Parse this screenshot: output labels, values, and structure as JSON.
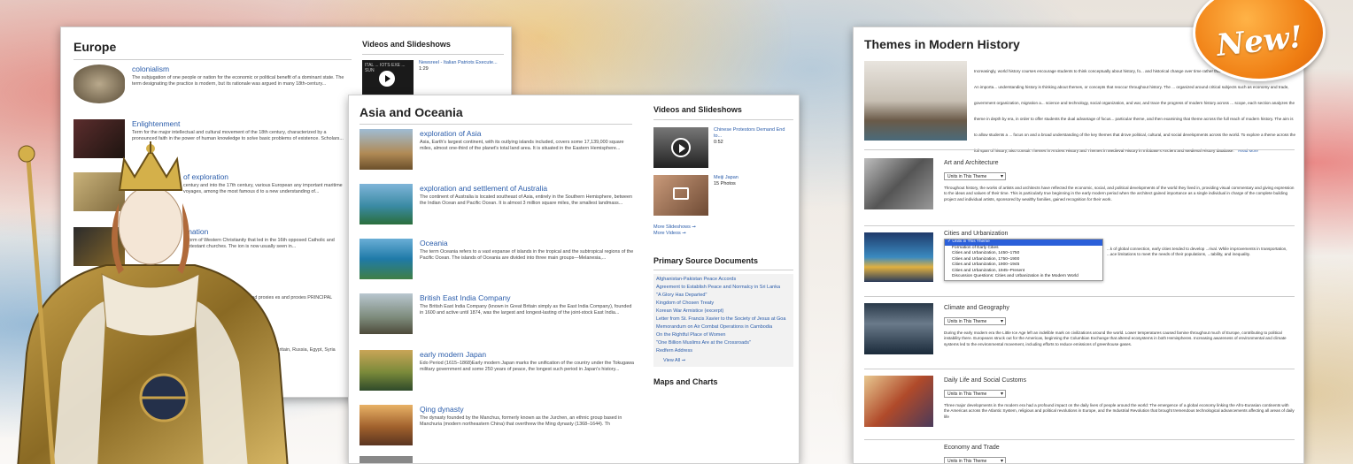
{
  "badge": "New!",
  "europe": {
    "title": "Europe",
    "entries": [
      {
        "title": "colonialism",
        "desc": "The subjugation of one people or nation for the economic or political benefit of a dominant state. The term designating the practice is modern, but its rationale was argued in many 18th-century..."
      },
      {
        "title": "Enlightenment",
        "desc": "Term for the major intellectual and cultural movement of the 18th century, characterized by a pronounced faith in the power of human knowledge to solve basic problems of existence. Scholars..."
      },
      {
        "title": "of exploration",
        "desc": "century and into the 17th century, various European any important maritime voyages, among the most famous d to a new understanding of..."
      },
      {
        "title": "rmation",
        "desc": "reform of Western Christianity that led in the 16th opposed Catholic and Protestant churches. The ion is now usually seen in..."
      },
      {
        "title": "",
        "desc": "tes and its capitalist allies and proxies es and proxies PRINCIPAL"
      },
      {
        "title": "",
        "desc": "an powers, Great Britain, Russia, Egypt, Syria"
      }
    ],
    "videos_title": "Videos and Slideshows",
    "video": {
      "title": "Newsreel - Italian Patriots Execute...",
      "duration": "1:29",
      "thumb_text": "ITAL ... IOTS EXE ... SUN"
    }
  },
  "asia": {
    "title": "Asia and Oceania",
    "entries": [
      {
        "title": "exploration of Asia",
        "desc": "Asia, Earth's largest continent, with its outlying islands included, covers some 17,139,000 square miles, almost one-third of the planet's total land area. It is situated in the Eastern Hemisphere..."
      },
      {
        "title": "exploration and settlement of Australia",
        "desc": "The continent of Australia is located southeast of Asia, entirely in the Southern Hemisphere, between the Indian Ocean and Pacific Ocean. It is almost 3 million square miles, the smallest landmass..."
      },
      {
        "title": "Oceania",
        "desc": "The term Oceania refers to a vast expanse of islands in the tropical and the subtropical regions of the Pacific Ocean. The islands of Oceania are divided into three main groups—Melanesia,..."
      },
      {
        "title": "British East India Company",
        "desc": "The British East India Company (known in Great Britain simply as the East India Company), founded in 1600 and active until 1874, was the largest and longest-lasting of the joint-stock East India..."
      },
      {
        "title": "early modern Japan",
        "desc": "Edo Period (1615–1868)Early modern Japan marks the unification of the country under the Tokugawa military government and some 250 years of peace, the longest such period in Japan's history..."
      },
      {
        "title": "Qing dynasty",
        "desc": "The dynasty founded by the Manchus, formerly known as the Jurchen, an ethnic group based in Manchuria (modern northeastern China) that overthrew the Ming dynasty (1368–1644). Th"
      }
    ],
    "videos_title": "Videos and Slideshows",
    "videos": [
      {
        "title": "Chinese Protestors Demand End to...",
        "meta": "0:52"
      },
      {
        "title": "Meiji Japan",
        "meta": "15 Photos"
      }
    ],
    "more_slideshows": "More Slideshows ➞",
    "more_videos": "More Videos ➞",
    "psd_title": "Primary Source Documents",
    "psd": [
      "Afghanistan-Pakistan Peace Accords",
      "Agreement to Establish Peace and Normalcy in Sri Lanka",
      "\"A Glory Has Departed\"",
      "Kingdom of Chosen Treaty",
      "Korean War Armistice (excerpt)",
      "Letter from St. Francis Xavier to the Society of Jesus at Goa",
      "Memorandum on Air Combat Operations in Cambodia",
      "On the Rightful Place of Women",
      "\"One Billion Muslims Are at the Crossroads\"",
      "Redfern Address"
    ],
    "view_all": "View All ➞",
    "maps_title": "Maps and Charts"
  },
  "themes": {
    "title": "Themes in Modern History",
    "intro": "Increasingly, world history courses encourage students to think conceptually about history, fo... and historical change over time rather than on the histories of individual civilizations. An importa... understanding history is thinking about themes, or concepts that reoccur throughout history. The ... organized around critical subjects such as economy and trade, government organization, migration a... science and technology, social organization, and war, and trace the progress of modern history across ... scope, each section analyzes the theme in depth by era, in order to offer students the dual advantage of focus... particular theme, and then examining that theme across the full reach of modern history. The aim is to allow students a ... focus on and a broad understanding of the key themes that drove political, cultural, and social developments across the world. To explore a theme across the full span of history, also consult Themes in Ancient History and Themes in Medieval History in Infobase's Ancient and Medieval History database.",
    "read_more": "Read More",
    "sections": [
      {
        "title": "Art and Architecture",
        "select": "Units in This Theme",
        "desc": "Throughout history, the works of artists and architects have reflected the economic, social, and political developments of the world they lived in, providing visual commentary and giving expression to the ideas and values of their time. This is particularly true beginning in the early modern period when the architect gained importance as a single individual in charge of the complete building project and individual artists, sponsored by wealthy families, gained recognition for their work."
      },
      {
        "title": "Cities and Urbanization",
        "select": "✓ Units in This Theme",
        "options": [
          "Formation of Early Cities",
          "Cities and Urbanization, 1450–1750",
          "Cities and Urbanization, 1750–1900",
          "Cities and Urbanization, 1900–1945",
          "Cities and Urbanization, 1945–Present",
          "Discussion Questions: Cities and Urbanization in the Modern World"
        ],
        "desc": "...k of global connection, early cities tended to develop ...rival. While improvements in transportation, ...ace limitations to meet the needs of their populations, ...tability, and inequality."
      },
      {
        "title": "Climate and Geography",
        "select": "Units in This Theme",
        "desc": "During the early modern era the Little Ice Age left an indelible mark on civilizations around the world. Lower temperatures caused famine throughout much of Europe, contributing to political instability there. Europeans struck out for the Americas, beginning the Columbian Exchange that altered ecosystems in both Hemispheres. Increasing awareness of environmental and climate systems led to the environmental movement, including efforts to reduce emissions of greenhouse gases."
      },
      {
        "title": "Daily Life and Social Customs",
        "select": "Units in This Theme",
        "desc": "Three major developments in the modern era had a profound impact on the daily lives of people around the world: The emergence of a global economy linking the Afro-Eurasian continents with the Americas across the Atlantic System, religious and political revolutions in Europe, and the Industrial Revolution that brought tremendous technological advancements affecting all areas of daily life"
      },
      {
        "title": "Economy and Trade",
        "select": "Units in This Theme",
        "desc": ""
      }
    ]
  }
}
